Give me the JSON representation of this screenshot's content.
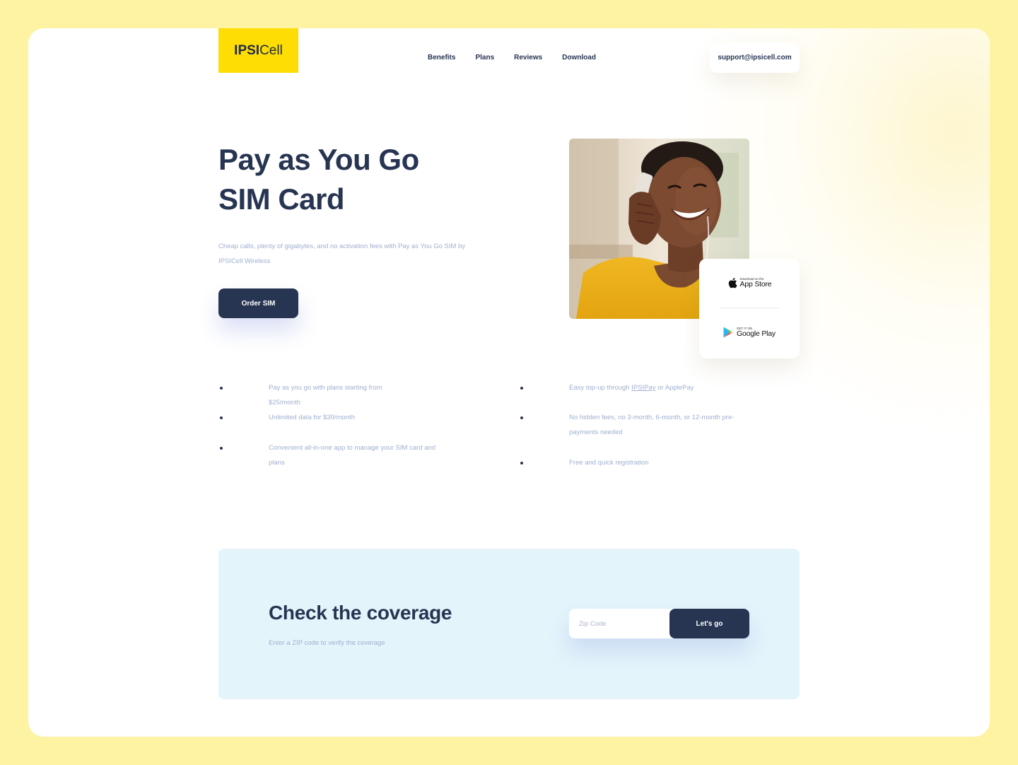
{
  "header": {
    "logo": {
      "bold": "IPSI",
      "regular": "Cell"
    },
    "nav": [
      {
        "label": "Benefits"
      },
      {
        "label": "Plans"
      },
      {
        "label": "Reviews"
      },
      {
        "label": "Download"
      }
    ],
    "support_email": "support@ipsicell.com"
  },
  "hero": {
    "title_line1": "Pay as You Go",
    "title_line2": "SIM Card",
    "description": "Cheap calls, plenty of gigabytes, and no activation fees with Pay as You Go SIM by IPSICell Wireless",
    "cta_label": "Order SIM"
  },
  "stores": {
    "app_store": {
      "small": "Download on the",
      "big": "App Store",
      "icon": "apple-icon"
    },
    "google_play": {
      "small": "GET IT ON",
      "big": "Google Play",
      "icon": "google-play-icon"
    }
  },
  "features": {
    "left": [
      {
        "text": "Pay as you go with plans starting from $25/month"
      },
      {
        "text": "Unlimited data for $39/month"
      },
      {
        "text": "Convenient all-in-one app to manage your SIM card and plans"
      }
    ],
    "right": [
      {
        "prefix": "Easy top-up through ",
        "link": "IPSIPay",
        "suffix": " or ApplePay"
      },
      {
        "text": "No hidden fees, no 3-month, 6-month, or 12-month pre-payments needed"
      },
      {
        "text": "Free and quick registration"
      }
    ]
  },
  "coverage": {
    "title": "Check the coverage",
    "subtitle": "Enter a ZIP code to verify the coverage",
    "zip_placeholder": "Zip Code",
    "zip_value": "",
    "button_label": "Let's go"
  },
  "colors": {
    "page_bg": "#fdf3a2",
    "brand_yellow": "#fddd03",
    "navy": "#273552",
    "muted_text": "#9fb0cf",
    "coverage_bg": "#e4f4fb"
  }
}
